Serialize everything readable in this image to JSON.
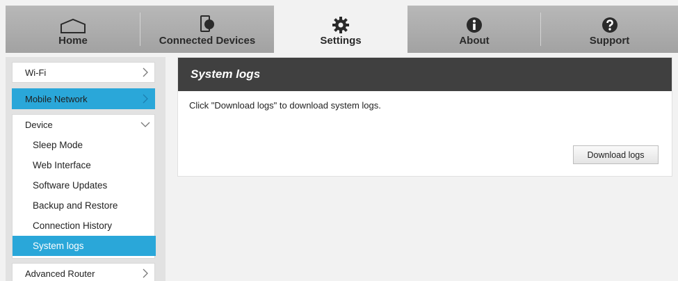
{
  "nav": {
    "tabs": [
      {
        "label": "Home",
        "icon": "home-icon"
      },
      {
        "label": "Connected Devices",
        "icon": "connected-devices-icon"
      },
      {
        "label": "Settings",
        "icon": "gear-icon"
      },
      {
        "label": "About",
        "icon": "info-icon"
      },
      {
        "label": "Support",
        "icon": "help-icon"
      }
    ],
    "active": "Settings"
  },
  "sidebar": {
    "items": [
      {
        "label": "Wi-Fi"
      },
      {
        "label": "Mobile Network"
      },
      {
        "label": "Device"
      },
      {
        "label": "Advanced Router"
      }
    ],
    "device_submenu": [
      {
        "label": "Sleep Mode"
      },
      {
        "label": "Web Interface"
      },
      {
        "label": "Software Updates"
      },
      {
        "label": "Backup and Restore"
      },
      {
        "label": "Connection History"
      },
      {
        "label": "System logs"
      }
    ]
  },
  "panel": {
    "title": "System logs",
    "description": "Click \"Download logs\" to download system logs.",
    "download_label": "Download logs"
  },
  "colors": {
    "accent": "#2aa7d9",
    "header_dark": "#404040",
    "nav_gray": "#aaaaaa"
  }
}
